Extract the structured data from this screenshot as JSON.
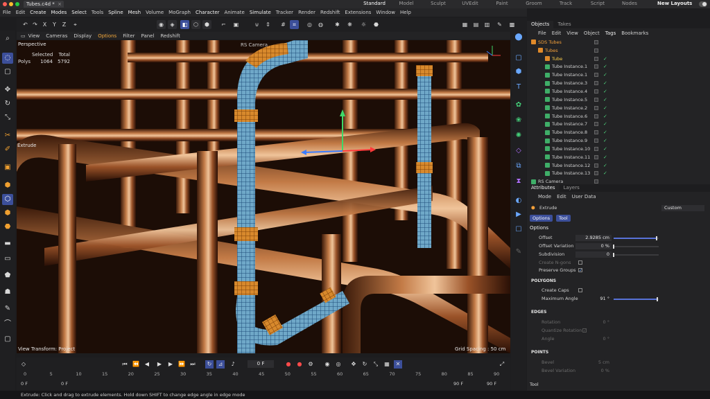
{
  "window": {
    "doc_tab": "Tubes.c4d *",
    "layout_tabs": [
      "Standard",
      "Model",
      "Sculpt",
      "UVEdit",
      "Paint",
      "Groom",
      "Track",
      "Script",
      "Nodes"
    ],
    "new_layouts": "New Layouts"
  },
  "menu": [
    "File",
    "Edit",
    "Create",
    "Modes",
    "Select",
    "Tools",
    "Spline",
    "Mesh",
    "Volume",
    "MoGraph",
    "Character",
    "Animate",
    "Simulate",
    "Tracker",
    "Render",
    "Redshift",
    "Extensions",
    "Window",
    "Help"
  ],
  "axis_toggles": [
    "X",
    "Y",
    "Z"
  ],
  "viewport": {
    "menu": [
      "View",
      "Cameras",
      "Display",
      "Options",
      "Filter",
      "Panel",
      "Redshift"
    ],
    "projection": "Perspective",
    "camera": "RS Camera",
    "hud": {
      "header_selected": "Selected",
      "header_total": "Total",
      "row_label": "Polys",
      "selected": "1064",
      "total": "5792"
    },
    "tool_label": "Extrude",
    "view_transform": "View Transform: Project",
    "grid_spacing": "Grid Spacing : 50 cm"
  },
  "objects": {
    "tabs": [
      "Objects",
      "Takes"
    ],
    "menu": [
      "File",
      "Edit",
      "View",
      "Object",
      "Tags",
      "Bookmarks"
    ],
    "rows": [
      {
        "name": "SDS Tubes",
        "indent": 0,
        "color": "orange"
      },
      {
        "name": "Tubes",
        "indent": 1,
        "color": "orange"
      },
      {
        "name": "Tube",
        "indent": 2,
        "color": "yellow"
      },
      {
        "name": "Tube Instance.1",
        "indent": 2,
        "color": "normal"
      },
      {
        "name": "Tube Instance.1",
        "indent": 2,
        "color": "normal"
      },
      {
        "name": "Tube Instance.3",
        "indent": 2,
        "color": "normal"
      },
      {
        "name": "Tube Instance.4",
        "indent": 2,
        "color": "normal"
      },
      {
        "name": "Tube Instance.5",
        "indent": 2,
        "color": "normal"
      },
      {
        "name": "Tube Instance.2",
        "indent": 2,
        "color": "normal"
      },
      {
        "name": "Tube Instance.6",
        "indent": 2,
        "color": "normal"
      },
      {
        "name": "Tube Instance.7",
        "indent": 2,
        "color": "normal"
      },
      {
        "name": "Tube Instance.8",
        "indent": 2,
        "color": "normal"
      },
      {
        "name": "Tube Instance.9",
        "indent": 2,
        "color": "normal"
      },
      {
        "name": "Tube Instance.10",
        "indent": 2,
        "color": "normal"
      },
      {
        "name": "Tube Instance.11",
        "indent": 2,
        "color": "normal"
      },
      {
        "name": "Tube Instance.12",
        "indent": 2,
        "color": "normal"
      },
      {
        "name": "Tube Instance.13",
        "indent": 2,
        "color": "normal"
      },
      {
        "name": "RS Camera",
        "indent": 0,
        "color": "normal"
      }
    ]
  },
  "attributes": {
    "tabs": [
      "Attributes",
      "Layers"
    ],
    "menu": [
      "Mode",
      "Edit",
      "User Data"
    ],
    "tool": "Extrude",
    "preset": "Custom",
    "subtabs": [
      "Options",
      "Tool"
    ],
    "options_title": "Options",
    "offset": {
      "label": "Offset",
      "value": "2.9285 cm",
      "level": 0.95
    },
    "offset_variation": {
      "label": "Offset Variation",
      "value": "0 %",
      "level": 0.0
    },
    "subdivision": {
      "label": "Subdivision",
      "value": "0",
      "level": 0.0
    },
    "create_ngons": {
      "label": "Create N-gons",
      "checked": false
    },
    "preserve_groups": {
      "label": "Preserve Groups",
      "checked": true
    },
    "polygons_title": "POLYGONS",
    "create_caps": {
      "label": "Create Caps",
      "checked": false
    },
    "max_angle": {
      "label": "Maximum Angle",
      "value": "91 °",
      "level": 0.97
    },
    "edges_title": "EDGES",
    "rotation": {
      "label": "Rotation",
      "value": "0 °"
    },
    "quantize_rotation": {
      "label": "Quantize Rotation",
      "checked": true
    },
    "angle": {
      "label": "Angle",
      "value": "0 °"
    },
    "points_title": "POINTS",
    "bevel": {
      "label": "Bevel",
      "value": "5 cm"
    },
    "bevel_variation": {
      "label": "Bevel Variation",
      "value": "0 %"
    },
    "footer": "Tool"
  },
  "timeline": {
    "current_frame": "0 F",
    "ticks": [
      "0",
      "5",
      "10",
      "15",
      "20",
      "25",
      "30",
      "35",
      "40",
      "45",
      "50",
      "55",
      "60",
      "65",
      "70",
      "75",
      "80",
      "85",
      "90"
    ],
    "range_start_a": "0 F",
    "range_start_b": "0 F",
    "range_end_a": "90 F",
    "range_end_b": "90 F"
  },
  "status": "Extrude: Click and drag to extrude elements. Hold down SHIFT to change edge angle in edge mode",
  "colors": {
    "accent": "#3c4f9a",
    "copper": "#b86a3a",
    "selection": "#f5a13a",
    "check": "#4ed07a"
  }
}
